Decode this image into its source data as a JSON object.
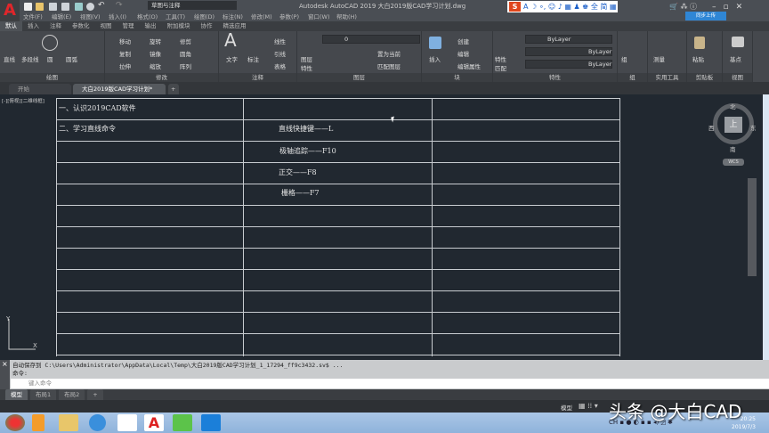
{
  "app": {
    "title": "Autodesk AutoCAD 2019   大白2019版CAD学习计划.dwg",
    "workspace": "草图与注释",
    "logo": "A"
  },
  "menu": [
    "文件(F)",
    "编辑(E)",
    "视图(V)",
    "插入(I)",
    "格式(O)",
    "工具(T)",
    "绘图(D)",
    "标注(N)",
    "修改(M)",
    "参数(P)",
    "窗口(W)",
    "帮助(H)"
  ],
  "ime": {
    "logo": "S",
    "icons": "A ☽ ∘, ☺ ♪ ▦ ♟ ♚ 全 简 ▦"
  },
  "cloud_label": "同步上传",
  "ribbon_tabs": [
    "默认",
    "插入",
    "注释",
    "参数化",
    "视图",
    "管理",
    "输出",
    "附加模块",
    "协作",
    "精选应用"
  ],
  "panels": {
    "draw": {
      "label": "绘图",
      "items": [
        "直线",
        "多段线",
        "圆",
        "圆弧"
      ]
    },
    "modify": {
      "label": "修改",
      "items": [
        "移动",
        "旋转",
        "修剪",
        "复制",
        "镜像",
        "圆角",
        "拉伸",
        "缩放",
        "阵列"
      ]
    },
    "annotation": {
      "label": "注释",
      "items": [
        "文字",
        "标注",
        "线性",
        "引线",
        "表格"
      ]
    },
    "layers": {
      "label": "图层",
      "items": [
        "图层特性",
        "置为当前",
        "匹配图层"
      ],
      "current": "0"
    },
    "block": {
      "label": "块",
      "items": [
        "插入",
        "创建",
        "编辑",
        "编辑属性"
      ]
    },
    "properties": {
      "label": "特性",
      "match": "特性匹配",
      "color": "ByLayer",
      "linetype": "ByLayer",
      "lineweight": "ByLayer"
    },
    "groups": {
      "label": "组",
      "items": [
        "组"
      ]
    },
    "utilities": {
      "label": "实用工具",
      "items": [
        "测量"
      ]
    },
    "clipboard": {
      "label": "剪贴板",
      "items": [
        "粘贴"
      ]
    },
    "view": {
      "label": "视图",
      "items": [
        "基点"
      ]
    }
  },
  "doc_tabs": [
    "开始",
    "大白2019版CAD学习计划*"
  ],
  "viewport_label": "[-][俯视][二维线框]",
  "table": [
    [
      "一、认识2019CAD软件",
      ""
    ],
    [
      "二、学习直线命令",
      "直线快捷键——L"
    ],
    [
      "",
      "极轴追踪——F10"
    ],
    [
      "",
      "正交——F8"
    ],
    [
      "",
      "栅格——F7"
    ]
  ],
  "viewcube": {
    "face": "上",
    "n": "北",
    "s": "南",
    "e": "东",
    "w": "西",
    "wcs": "WCS"
  },
  "ucs": {
    "x": "X",
    "y": "Y"
  },
  "command": {
    "history1": "自动保存到 C:\\Users\\Administrator\\AppData\\Local\\Temp\\大白2019版CAD学习计划_1_17294_ff9c3432.sv$ ...",
    "history2": "命令:",
    "placeholder": "键入命令"
  },
  "layout_tabs": [
    "模型",
    "布局1",
    "布局2",
    "+"
  ],
  "status": {
    "model": "模型"
  },
  "watermark": "头条 @大白CAD",
  "clock": {
    "time": "20:25",
    "date": "2019/7/3"
  },
  "colors": {
    "canvas": "#212830",
    "ribbon": "#45484d",
    "accent": "#e0262b"
  }
}
